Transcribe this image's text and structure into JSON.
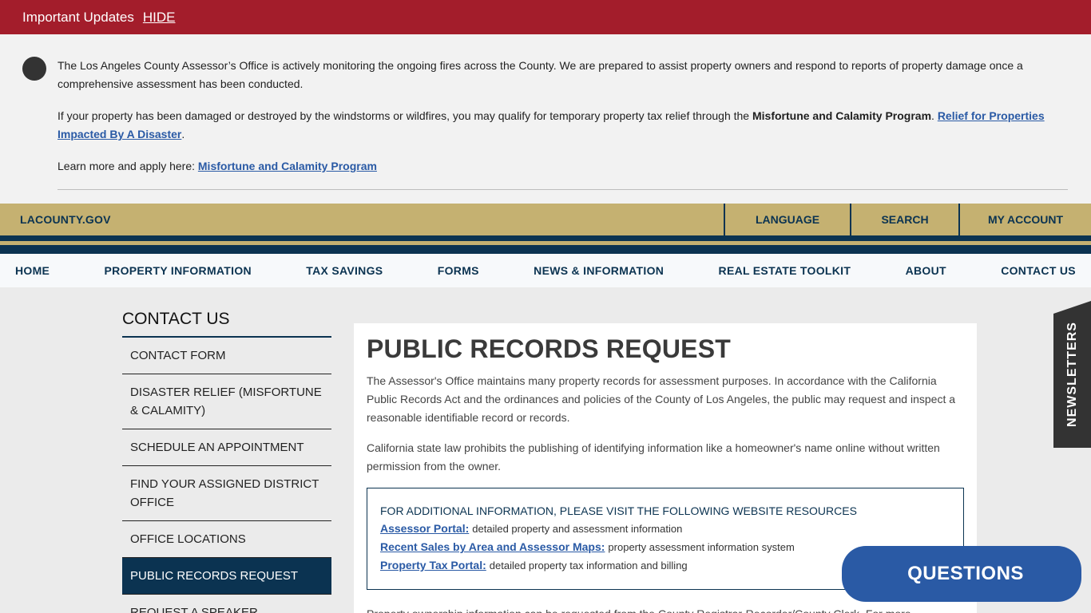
{
  "alert": {
    "title": "Important Updates",
    "hide_label": "HIDE",
    "icon": "info-icon",
    "icon_glyph": "",
    "p1": "The Los Angeles County Assessor’s Office is actively monitoring the ongoing fires across the County. We are prepared to assist property owners and respond to reports of property damage once a comprehensive assessment has been conducted.",
    "p2_text": "If your property has been damaged or destroyed by the windstorms or wildfires, you may qualify for temporary property tax relief through the ",
    "p2_bold": "Misfortune and Calamity Program",
    "p2_sep": ". ",
    "p2_link": "Relief for Properties Impacted By A Disaster",
    "p2_end": ".",
    "p3_text": "Learn more and apply here: ",
    "p3_link": "Misfortune and Calamity Program"
  },
  "utility": {
    "lacounty": "LACOUNTY.GOV",
    "language": "LANGUAGE ",
    "search": "SEARCH ",
    "account": "MY ACCOUNT "
  },
  "nav": {
    "items": [
      "HOME",
      "PROPERTY INFORMATION",
      "TAX SAVINGS",
      "FORMS",
      "NEWS & INFORMATION",
      "REAL ESTATE TOOLKIT",
      "ABOUT",
      "CONTACT US"
    ]
  },
  "sidebar": {
    "title": "CONTACT US",
    "items": [
      {
        "label": "CONTACT FORM"
      },
      {
        "label": "DISASTER RELIEF (MISFORTUNE & CALAMITY)"
      },
      {
        "label": "SCHEDULE AN APPOINTMENT"
      },
      {
        "label": "FIND YOUR ASSIGNED DISTRICT OFFICE"
      },
      {
        "label": "OFFICE LOCATIONS"
      },
      {
        "label": "PUBLIC RECORDS REQUEST"
      },
      {
        "label": "REQUEST A SPEAKER"
      }
    ]
  },
  "content": {
    "title": "PUBLIC RECORDS REQUEST",
    "p1": "The Assessor's Office maintains many property records for assessment purposes. In accordance with the California Public Records Act and the ordinances and policies of the County of Los Angeles, the public may request and inspect a reasonable identifiable record or records.",
    "p2": "California state law prohibits the publishing of identifying information like a homeowner's name online without written permission from the owner.",
    "resources": {
      "heading": "FOR ADDITIONAL INFORMATION, PLEASE VISIT THE FOLLOWING WEBSITE RESOURCES",
      "rows": [
        {
          "link": "Assessor Portal:",
          "desc": "detailed property and assessment information"
        },
        {
          "link": "Recent Sales by Area and Assessor Maps:",
          "desc": "property assessment information system"
        },
        {
          "link": "Property Tax Portal:",
          "desc": "detailed property tax information and billing"
        }
      ]
    },
    "p3": "Property ownership information can be requested from the County Registrar-Recorder/County Clerk. For more"
  },
  "newsletter": {
    "label": "NEWSLETTERS"
  },
  "questions": {
    "icon": "",
    "label": "QUESTIONS"
  }
}
